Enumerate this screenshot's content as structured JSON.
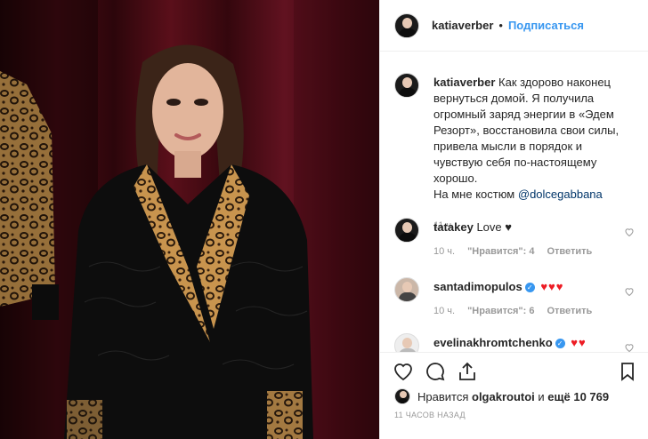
{
  "header": {
    "username": "katiaverber",
    "separator": "•",
    "follow_label": "Подписаться"
  },
  "caption": {
    "username": "katiaverber",
    "text": "Как здорово наконец вернуться домой. Я получила огромный заряд энергии в «Эдем Резорт», восстановила свои силы, привела мысли в порядок и чувствую себя по-настоящему хорошо.",
    "suffix": "На мне костюм",
    "mention": "@dolcegabbana",
    "time": "11 ч."
  },
  "comments": [
    {
      "username": "tatakey",
      "text": "Love ♥",
      "time": "10 ч.",
      "likes": "",
      "reply": "Ответить"
    },
    {
      "username": "santadimopulos",
      "verified": true,
      "text": "♥♥♥",
      "time": "10 ч.",
      "likes": "\"Нравится\": 6",
      "reply": "Ответить"
    },
    {
      "username": "evelinakhromtchenko",
      "verified": true,
      "text": "♥♥",
      "time": "",
      "likes": "",
      "reply": ""
    }
  ],
  "comment1_likes": "\"Нравится\": 4",
  "likes": {
    "prefix": "Нравится",
    "user": "olgakroutoi",
    "connector": "и",
    "count": "ещё 10 769"
  },
  "timestamp": "11 ЧАСОВ НАЗАД",
  "colors": {
    "accent": "#3897f0",
    "heart": "#ed1c24",
    "text": "#262626",
    "muted": "#999999"
  }
}
